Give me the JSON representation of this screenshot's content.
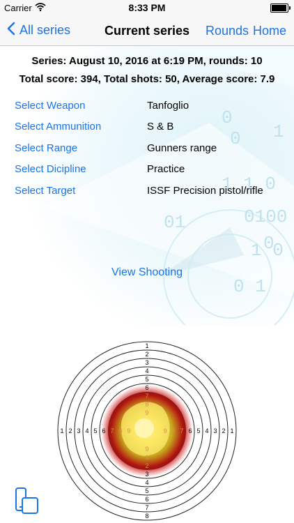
{
  "status_bar": {
    "carrier": "Carrier",
    "time": "8:33 PM",
    "battery_level": 0.95
  },
  "nav": {
    "back_label": "All series",
    "title": "Current series",
    "rounds_label": "Rounds",
    "home_label": "Home"
  },
  "summary": {
    "line1": "Series: August 10, 2016 at 6:19 PM, rounds: 10",
    "line2": "Total score: 394, Total shots: 50, Average score: 7.9"
  },
  "details": [
    {
      "label": "Select Weapon",
      "value": "Tanfoglio"
    },
    {
      "label": "Select Ammunition",
      "value": "S & B"
    },
    {
      "label": "Select Range",
      "value": "Gunners range"
    },
    {
      "label": "Select Dicipline",
      "value": "Practice"
    },
    {
      "label": "Select Target",
      "value": "ISSF Precision pistol/rifle"
    }
  ],
  "view_shooting_label": "View Shooting",
  "background_glyphs": [
    "0",
    "1",
    "0",
    "1 1 0",
    "01",
    "0100",
    "0",
    "1 0",
    "0 1"
  ],
  "target": {
    "labels_top": [
      "1",
      "2",
      "3",
      "4",
      "5",
      "6",
      "7",
      "8"
    ],
    "labels_bottom": [
      "8",
      "7",
      "6",
      "5",
      "4",
      "3",
      "2",
      "1"
    ],
    "labels_left": [
      "1",
      "2",
      "3",
      "4",
      "5",
      "6",
      "7",
      "8"
    ],
    "labels_right": [
      "8",
      "7",
      "6",
      "5",
      "4",
      "3",
      "2",
      "1"
    ],
    "inner_labels": [
      "9",
      "9",
      "9",
      "9"
    ]
  },
  "colors": {
    "accent": "#1a73e8",
    "navbar_bg": "#f7f7f7"
  },
  "icons": [
    "wifi-icon",
    "battery-icon",
    "chevron-left-icon",
    "device-switch-icon",
    "target-icon"
  ]
}
